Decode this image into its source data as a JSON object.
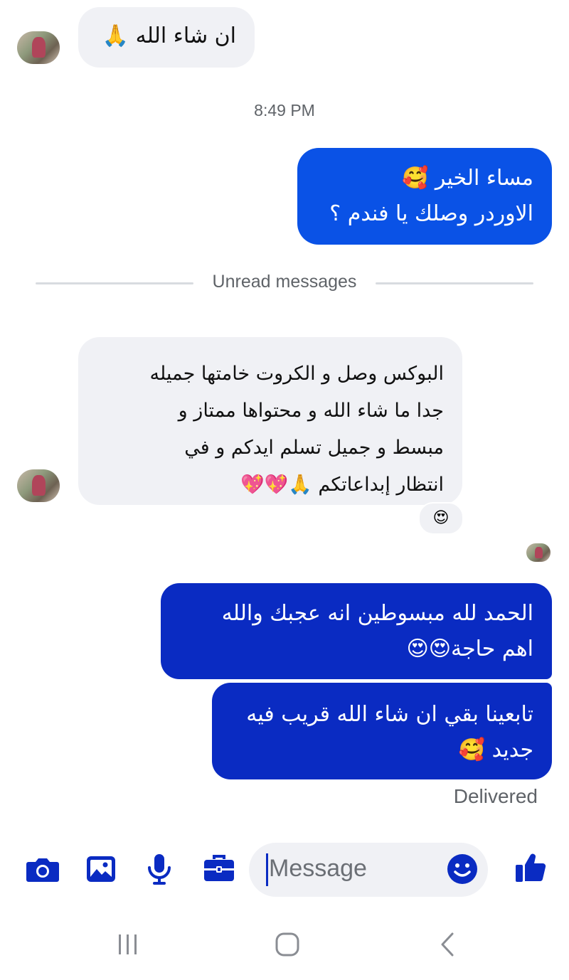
{
  "messages": [
    {
      "direction": "incoming",
      "lines": [
        "ان شاء الله 🙏"
      ]
    },
    {
      "direction": "outgoing",
      "lines": [
        "مساء الخير 🥰",
        "الاوردر وصلك يا فندم ؟"
      ]
    },
    {
      "direction": "incoming",
      "lines": [
        "البوكس وصل و الكروت خامتها جميله",
        "جدا ما شاء الله و محتواها ممتاز و",
        "مبسط و جميل تسلم ايدكم و في",
        "انتظار إبداعاتكم 🙏💖💖"
      ],
      "reaction": "😍"
    },
    {
      "direction": "outgoing",
      "lines": [
        "الحمد لله مبسوطين انه عجبك والله",
        "اهم حاجة😍😍"
      ]
    },
    {
      "direction": "outgoing",
      "lines": [
        "تابعينا بقي ان شاء الله قريب فيه",
        "جديد 🥰"
      ]
    }
  ],
  "timestamp": "8:49 PM",
  "divider": "Unread messages",
  "status": "Delivered",
  "composer": {
    "placeholder": "Message"
  },
  "toolbar_icons": [
    "camera-icon",
    "image-icon",
    "microphone-icon",
    "briefcase-icon",
    "emoji-icon",
    "thumbs-up-icon"
  ],
  "nav_icons": [
    "recent-apps-icon",
    "home-icon",
    "back-icon"
  ],
  "colors": {
    "outgoing_primary": "#0a52e6",
    "outgoing_secondary": "#0a2bc2",
    "incoming": "#f0f1f5",
    "icon": "#0a2bc2"
  }
}
